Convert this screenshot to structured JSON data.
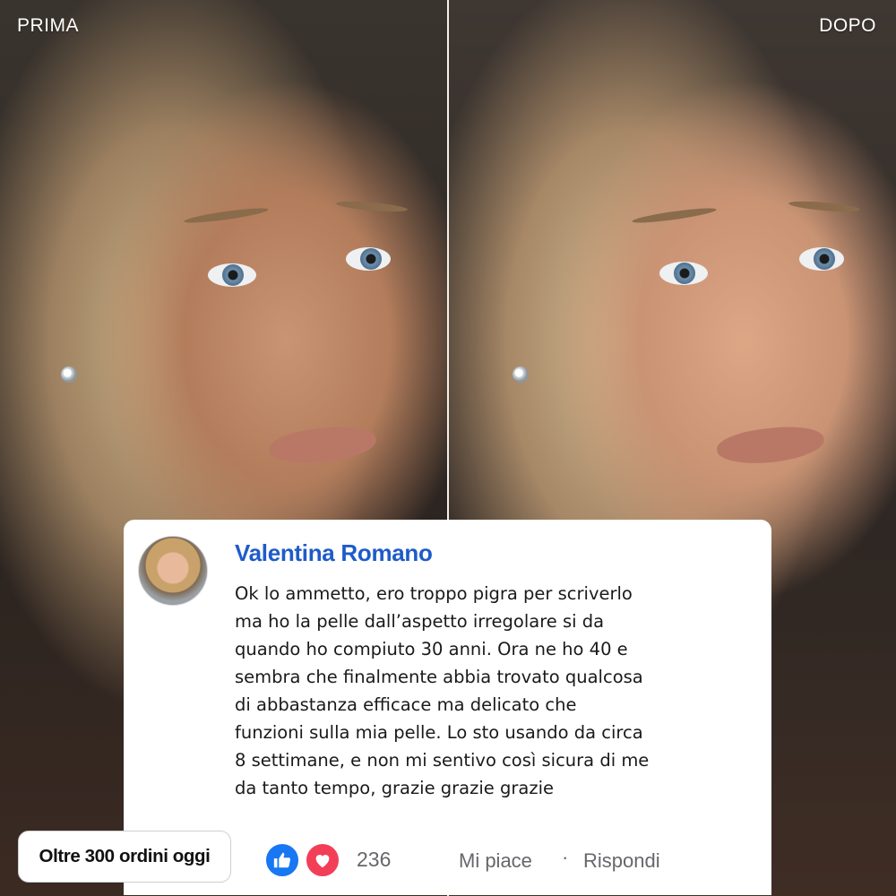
{
  "labels": {
    "before": "PRIMA",
    "after": "DOPO"
  },
  "comment": {
    "author": "Valentina Romano",
    "text": "Ok lo ammetto, ero troppo pigra per scriverlo\nma ho la pelle dall’aspetto irregolare si da\nquando ho compiuto 30 anni. Ora ne ho 40 e\nsembra che finalmente abbia trovato qualcosa\ndi abbastanza efficace ma delicato che\nfunzioni sulla mia pelle. Lo sto usando da circa\n8 settimane, e non mi sentivo così sicura di me\nda tanto tempo, grazie grazie grazie",
    "reaction_count": "236",
    "like_label": "Mi piace",
    "separator": "·",
    "reply_label": "Rispondi",
    "reaction_icons": [
      "thumbs-up-icon",
      "heart-icon"
    ]
  },
  "badge": {
    "text": "Oltre 300 ordini oggi"
  },
  "colors": {
    "author_name": "#1f5bc9",
    "like_blue": "#1877f2",
    "love_red": "#f33e58",
    "meta_gray": "#65676b"
  }
}
